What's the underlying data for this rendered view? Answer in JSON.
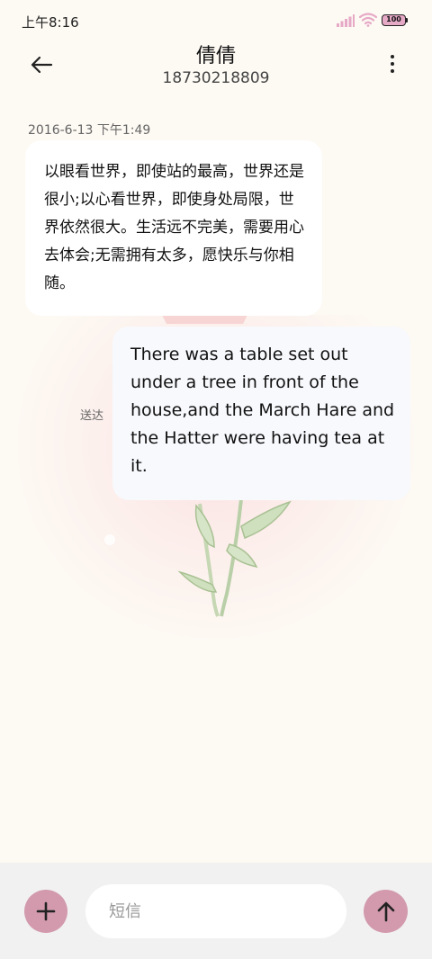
{
  "status_bar": {
    "time": "上午8:16",
    "battery": "100",
    "accent_color": "#e6a9c6"
  },
  "header": {
    "contact_name": "倩倩",
    "contact_number": "18730218809",
    "back_icon": "arrow-left-icon",
    "more_icon": "more-vertical-icon"
  },
  "conversation": {
    "timestamp": "2016-6-13 下午1:49",
    "received_message": "以眼看世界，即使站的最高，世界还是很小;以心看世界，即使身处局限，世界依然很大。生活远不完美，需要用心去体会;无需拥有太多，愿快乐与你相随。",
    "sent_message": "There was a table set out under a tree in front of the house,and the March Hare and the Hatter were having tea at it.",
    "delivery_status": "送达"
  },
  "composer": {
    "placeholder": "短信",
    "add_icon": "plus-icon",
    "send_icon": "arrow-up-icon",
    "button_color": "#d29aac"
  }
}
